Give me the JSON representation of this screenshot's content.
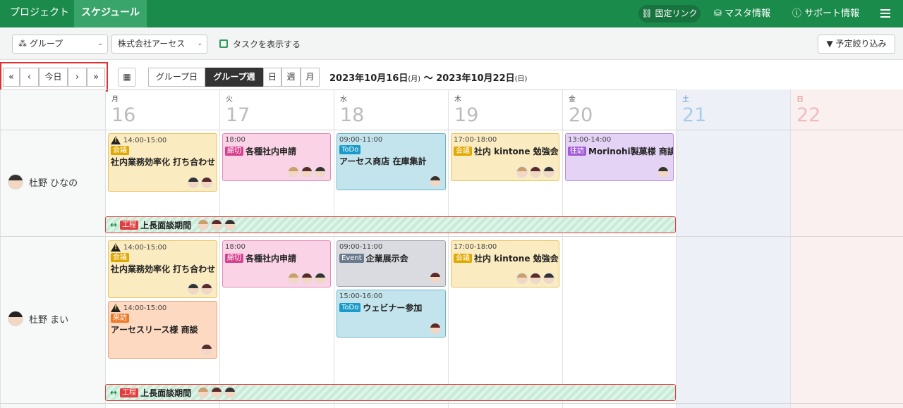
{
  "topnav": {
    "tabs": [
      "プロジェクト",
      "スケジュール"
    ],
    "fixed_link": "固定リンク",
    "master": "マスタ情報",
    "support": "サポート情報"
  },
  "filters": {
    "group": "グループ",
    "company": "株式会社アーセス",
    "show_tasks": "タスクを表示する",
    "narrow": "予定絞り込み"
  },
  "nav": {
    "first": "«",
    "prev": "‹",
    "today": "今日",
    "next": "›",
    "last": "»"
  },
  "views": [
    "グループ日",
    "グループ週",
    "日",
    "週",
    "月"
  ],
  "range": {
    "start": "2023年10月16日",
    "start_wd": "(月)",
    "sep": "～",
    "end": "2023年10月22日",
    "end_wd": "(日)"
  },
  "days": [
    {
      "w": "月",
      "n": "16"
    },
    {
      "w": "火",
      "n": "17"
    },
    {
      "w": "水",
      "n": "18"
    },
    {
      "w": "木",
      "n": "19"
    },
    {
      "w": "金",
      "n": "20"
    },
    {
      "w": "土",
      "n": "21"
    },
    {
      "w": "日",
      "n": "22"
    }
  ],
  "users": [
    {
      "name": "杜野 ひなの",
      "bar": {
        "tag": "工程",
        "title": "上長面談期間"
      },
      "events": [
        {
          "time": "14:00-15:00",
          "tag": "会議",
          "title": "社内業務効率化 打ち合わせ"
        },
        {
          "time": "18:00",
          "tag": "締切",
          "title": "各種社内申請"
        },
        {
          "time": "09:00-11:00",
          "tag": "ToDo",
          "title": "アーセス商店 在庫集計"
        },
        {
          "time": "17:00-18:00",
          "tag": "会議",
          "title": "社内 kintone 勉強会"
        },
        {
          "time": "13:00-14:00",
          "tag": "往訪",
          "title": "Morinohi製菓様 商談"
        }
      ]
    },
    {
      "name": "杜野 まい",
      "bar": {
        "tag": "工程",
        "title": "上長面談期間"
      },
      "events": [
        {
          "time": "14:00-15:00",
          "tag": "会議",
          "title": "社内業務効率化 打ち合わせ"
        },
        {
          "time": "14:00-15:00",
          "tag": "来訪",
          "title": "アーセスリース様 商談"
        },
        {
          "time": "18:00",
          "tag": "締切",
          "title": "各種社内申請"
        },
        {
          "time": "09:00-11:00",
          "tag": "Event",
          "title": "企業展示会"
        },
        {
          "time": "15:00-16:00",
          "tag": "ToDo",
          "title": "ウェビナー参加"
        },
        {
          "time": "17:00-18:00",
          "tag": "会議",
          "title": "社内 kintone 勉強会"
        }
      ]
    }
  ]
}
